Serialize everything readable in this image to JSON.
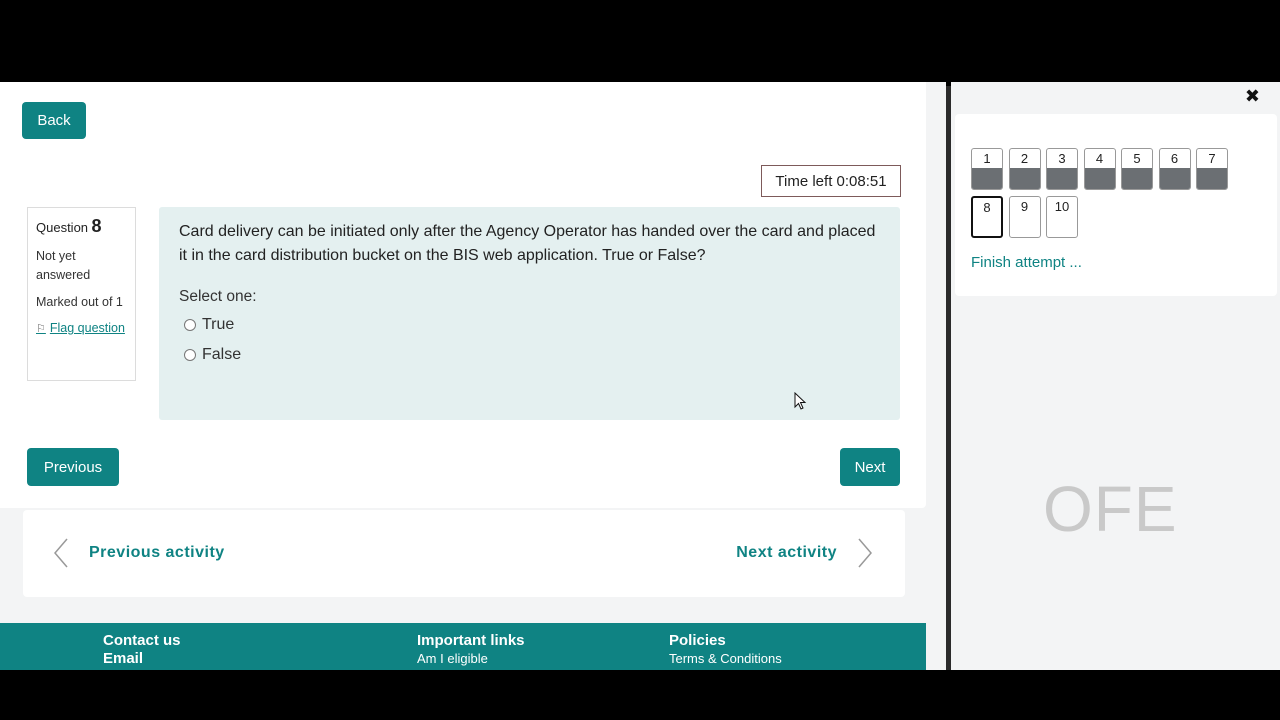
{
  "header": {
    "back_label": "Back"
  },
  "timer": {
    "text": "Time left 0:08:51"
  },
  "question_info": {
    "label": "Question",
    "number": "8",
    "state": "Not yet answered",
    "marked": "Marked out of 1",
    "flag_label": "Flag question"
  },
  "question": {
    "text": "Card delivery can be initiated only after the Agency Operator has handed over the card and placed it in the card distribution bucket on the BIS web application. True or False?",
    "prompt": "Select one:",
    "options": [
      {
        "label": "True",
        "selected": false
      },
      {
        "label": "False",
        "selected": false
      }
    ]
  },
  "navigation": {
    "previous_label": "Previous",
    "next_label": "Next"
  },
  "activity_nav": {
    "previous_label": "Previous activity",
    "next_label": "Next activity"
  },
  "footer": {
    "contact": {
      "heading": "Contact us",
      "sub": "Email"
    },
    "links": {
      "heading": "Important links",
      "item": "Am I eligible"
    },
    "policies": {
      "heading": "Policies",
      "item": "Terms & Conditions"
    }
  },
  "quiz_nav": {
    "buttons": [
      {
        "label": "1",
        "status": "answered"
      },
      {
        "label": "2",
        "status": "answered"
      },
      {
        "label": "3",
        "status": "answered"
      },
      {
        "label": "4",
        "status": "answered"
      },
      {
        "label": "5",
        "status": "answered"
      },
      {
        "label": "6",
        "status": "answered"
      },
      {
        "label": "7",
        "status": "answered"
      },
      {
        "label": "8",
        "status": "current"
      },
      {
        "label": "9",
        "status": "unanswered"
      },
      {
        "label": "10",
        "status": "unanswered"
      }
    ],
    "finish_label": "Finish attempt ..."
  },
  "watermark": "OFE",
  "colors": {
    "accent": "#0f8383",
    "question_bg": "#e4f0f0",
    "answered_fill": "#6b6f73"
  }
}
